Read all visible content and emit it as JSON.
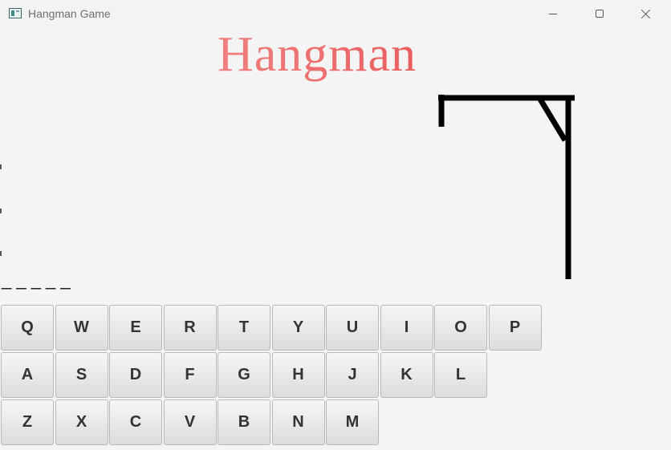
{
  "window": {
    "title": "Hangman Game",
    "app_icon": "app-window-icon",
    "controls": {
      "minimize_icon": "minimize-icon",
      "maximize_icon": "maximize-icon",
      "close_icon": "close-icon"
    }
  },
  "game": {
    "title": "Hangman",
    "title_colors": [
      "#f7a7a7",
      "#e33b3b"
    ],
    "word_display": "_ _ _ _ _",
    "hangman_stage": "gallows-only"
  },
  "keyboard": {
    "rows": [
      [
        "Q",
        "W",
        "E",
        "R",
        "T",
        "Y",
        "U",
        "I",
        "O",
        "P"
      ],
      [
        "A",
        "S",
        "D",
        "F",
        "G",
        "H",
        "J",
        "K",
        "L"
      ],
      [
        "Z",
        "X",
        "C",
        "V",
        "B",
        "N",
        "M"
      ]
    ]
  }
}
